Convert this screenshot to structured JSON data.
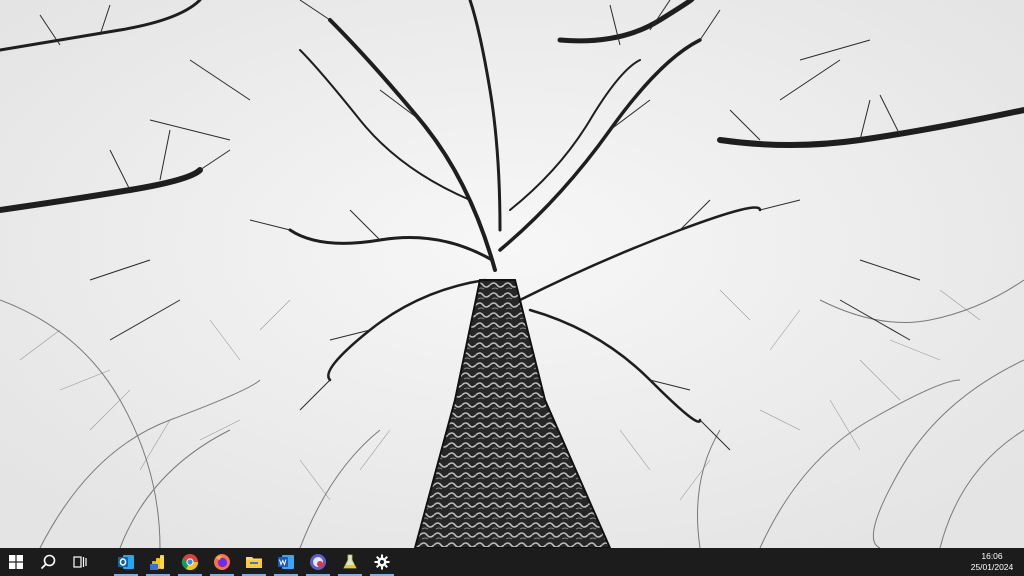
{
  "wallpaper": {
    "icon": "tree-canopy-wallpaper",
    "sky_color": "#f3f3f3",
    "trunk_color": "#1e1e1e"
  },
  "taskbar": {
    "background": "#1c1c1c",
    "indicator_color": "#7fb1e6",
    "buttons": [
      {
        "icon": "windows-start-icon"
      },
      {
        "icon": "search-icon"
      },
      {
        "icon": "task-view-icon"
      },
      {
        "icon": "outlook-icon",
        "running": true
      },
      {
        "icon": "powerbi-icon",
        "running": true
      },
      {
        "icon": "chrome-icon",
        "running": true
      },
      {
        "icon": "firefox-icon",
        "running": true
      },
      {
        "icon": "file-explorer-icon",
        "running": true
      },
      {
        "icon": "word-icon",
        "running": true
      },
      {
        "icon": "app-icon",
        "running": true
      },
      {
        "icon": "flask-icon",
        "running": true
      },
      {
        "icon": "settings-gear-icon",
        "running": true
      }
    ],
    "clock": {
      "time": "16:06",
      "date": "25/01/2024"
    }
  }
}
